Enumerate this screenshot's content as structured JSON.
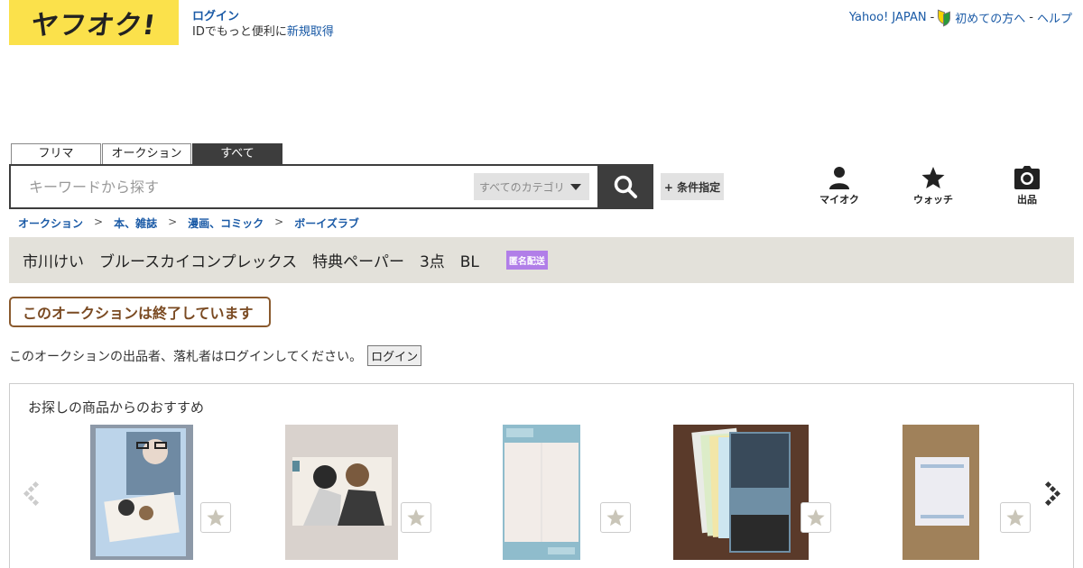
{
  "header": {
    "logo_text": "ヤフオク!",
    "login_label": "ログイン",
    "id_prefix": "IDでもっと便利に",
    "signup_label": "新規取得",
    "links": [
      "Yahoo! JAPAN",
      "初めての方へ",
      "ヘルプ"
    ],
    "link_sep": "-"
  },
  "search": {
    "tabs": [
      "フリマ",
      "オークション",
      "すべて"
    ],
    "active_tab": 2,
    "placeholder": "キーワードから探す",
    "category_label": "すべてのカテゴリ",
    "condition_button": "+ 条件指定"
  },
  "nav_icons": [
    {
      "label": "マイオク",
      "icon": "user-icon"
    },
    {
      "label": "ウォッチ",
      "icon": "star-icon"
    },
    {
      "label": "出品",
      "icon": "camera-icon"
    }
  ],
  "breadcrumb": {
    "items": [
      "オークション",
      "本、雑誌",
      "漫画、コミック",
      "ボーイズラブ"
    ],
    "separator": ">"
  },
  "item": {
    "title": "市川けい　ブルースカイコンプレックス　特典ペーパー　3点　BL",
    "badge": "匿名配送",
    "ended_message": "このオークションは終了しています",
    "login_notice": "このオークションの出品者、落札者はログインしてください。",
    "login_button": "ログイン"
  },
  "recommendations": {
    "title": "お探しの商品からのおすすめ",
    "items": [
      {
        "image": "manga-bookmark-photo"
      },
      {
        "image": "illustration-card-photo"
      },
      {
        "image": "paper-sheet-photo"
      },
      {
        "image": "manga-volumes-stack-photo"
      },
      {
        "image": "paper-on-cardboard-photo"
      }
    ]
  },
  "colors": {
    "logo_bg": "#fbe14b",
    "link": "#1a5aa6",
    "dark": "#3d3d3d",
    "title_bar": "#e3e1da",
    "badge": "#b17ee8",
    "ended_border": "#8a5a2e"
  }
}
